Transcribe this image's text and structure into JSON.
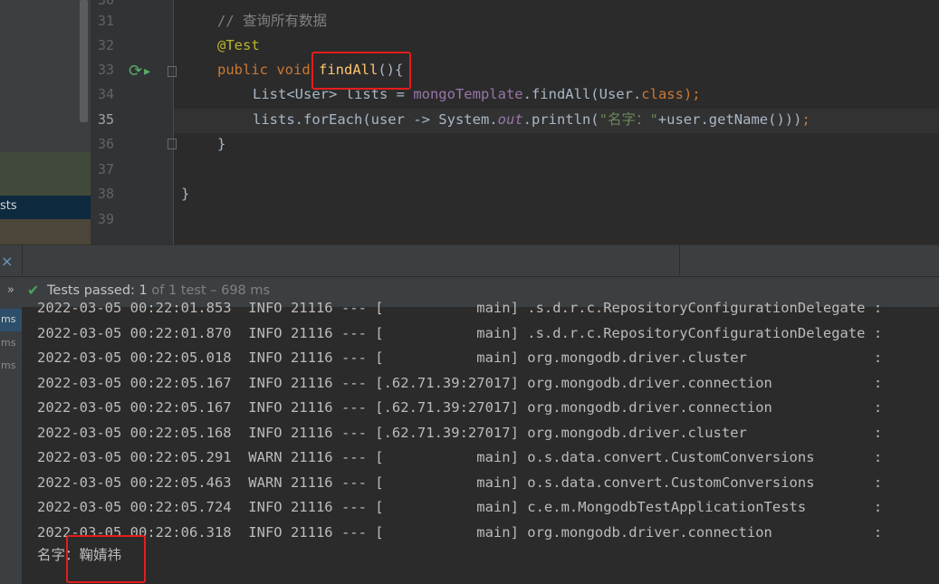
{
  "left_panel": {
    "selected_item": "sts"
  },
  "editor": {
    "line_numbers": [
      "31",
      "32",
      "33",
      "34",
      "35",
      "36",
      "37",
      "38",
      "39"
    ],
    "current_line": "35",
    "comment": "// 查询所有数据",
    "annotation": "@Test",
    "kw_public": "public ",
    "kw_void": "void ",
    "method_name": "findAll",
    "method_params": "(){",
    "line34_pre": "List<User> lists = ",
    "line34_field": "mongoTemplate",
    "line34_post": ".findAll(User.",
    "line34_class": "class",
    "line34_semi": ");",
    "line35_pre": "lists.forEach(user -> System.",
    "line35_out": "out",
    "line35_mid": ".println(",
    "line35_str": "\"名字：\"",
    "line35_post": "+user.getName()))",
    "line35_semi": ";",
    "line36": "}",
    "line38": "}"
  },
  "run": {
    "close_label": "×",
    "expand_label": "»",
    "status_main": "Tests passed: 1",
    "status_muted": " of 1 test – 698 ms",
    "durations": [
      "ms",
      "ms",
      "ms"
    ]
  },
  "console": {
    "lines": [
      "2022-03-05 00:22:01.853  INFO 21116 --- [           main] .s.d.r.c.RepositoryConfigurationDelegate :",
      "2022-03-05 00:22:01.870  INFO 21116 --- [           main] .s.d.r.c.RepositoryConfigurationDelegate :",
      "2022-03-05 00:22:05.018  INFO 21116 --- [           main] org.mongodb.driver.cluster               :",
      "2022-03-05 00:22:05.167  INFO 21116 --- [.62.71.39:27017] org.mongodb.driver.connection            :",
      "2022-03-05 00:22:05.167  INFO 21116 --- [.62.71.39:27017] org.mongodb.driver.connection            :",
      "2022-03-05 00:22:05.168  INFO 21116 --- [.62.71.39:27017] org.mongodb.driver.cluster               :",
      "2022-03-05 00:22:05.291  WARN 21116 --- [           main] o.s.data.convert.CustomConversions       :",
      "2022-03-05 00:22:05.463  WARN 21116 --- [           main] o.s.data.convert.CustomConversions       :",
      "2022-03-05 00:22:05.724  INFO 21116 --- [           main] c.e.m.MongodbTestApplicationTests        :",
      "2022-03-05 00:22:06.318  INFO 21116 --- [           main] org.mongodb.driver.connection            :"
    ],
    "output": "名字：鞠婧祎"
  },
  "colors": {
    "highlight_box": "#e51c1c",
    "pass_green": "#49a05a"
  },
  "icons": [
    "run-test-icon",
    "check-icon",
    "close-icon"
  ]
}
